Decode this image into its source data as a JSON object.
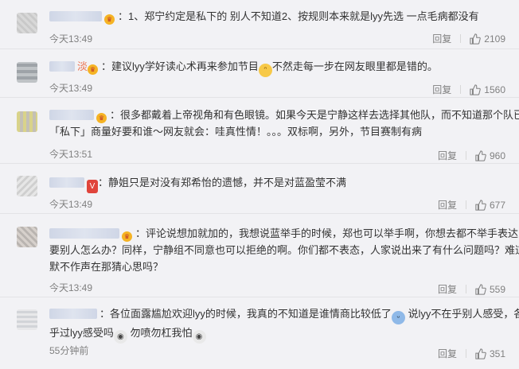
{
  "comments": [
    {
      "text_a": "1、郑宁约定是私下的 别人不知道2、按规则本来就是lyy先选 一点毛病都没有",
      "time": "今天13:49",
      "reply": "回复",
      "likes": "2109"
    },
    {
      "name_tail": "淡",
      "text_a": "建议lyy学好读心术再来参加节目",
      "text_b": "不然走每一步在网友眼里都是错的。",
      "time": "今天13:49",
      "reply": "回复",
      "likes": "1560"
    },
    {
      "line1": "很多都戴着上帝视角和有色眼镜。如果今天是宁静这样去选择其他队，而不知道那个队已经",
      "line2": "「私下」商量好要和谁～网友就会：哇真性情！。。。双标啊，另外，节目赛制有病",
      "time": "今天13:51",
      "reply": "回复",
      "likes": "960"
    },
    {
      "text_a": "静姐只是对没有郑希怡的遗憾，并不是对蓝盈莹不满",
      "time": "今天13:49",
      "reply": "回复",
      "likes": "677"
    },
    {
      "line1": "评论说想加就加的，我想说蓝举手的时候，郑也可以举手啊，你想去都不举手表达",
      "line2": "要别人怎么办？同样，宁静组不同意也可以拒绝的啊。你们都不表态，人家说出来了有什么问题吗？难道都",
      "line3": "默不作声在那猜心思吗？",
      "time": "今天13:49",
      "reply": "回复",
      "likes": "559"
    },
    {
      "line1a": "各位面露尴尬欢迎lyy的时候，我真的不知道是谁情商比较低了",
      "line1b": "说lyy不在乎别人感受，各位在",
      "line2a": "乎过lyy感受吗",
      "line2b": "勿喷勿杠我怕",
      "time": "55分钟前",
      "reply": "回复",
      "likes": "351"
    }
  ],
  "icons": {
    "crown": "crown-icon",
    "thumb": "thumb-up-icon",
    "colors": {
      "name": "#eb7350",
      "meta": "#808080",
      "bg": "#f2f2f5"
    }
  }
}
